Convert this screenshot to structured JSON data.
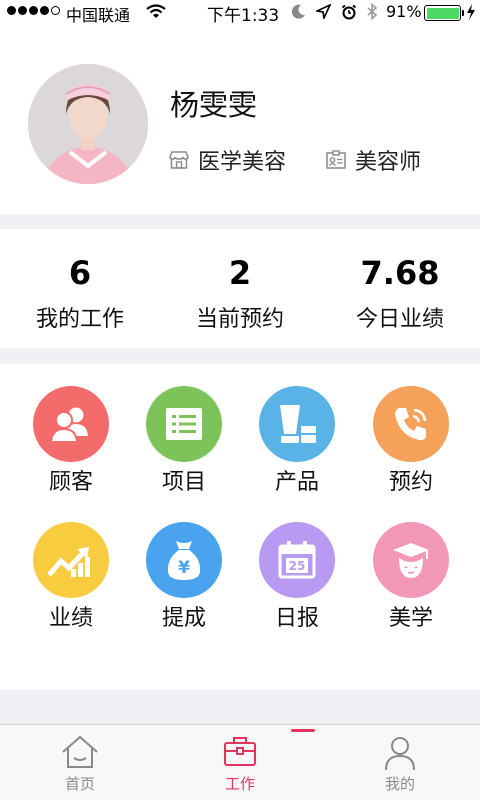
{
  "status_bar": {
    "carrier": "中国联通",
    "time": "下午1:33",
    "battery_percent": "91%",
    "battery_level": 0.91
  },
  "profile": {
    "name": "杨雯雯",
    "tags": [
      {
        "icon": "store-icon",
        "label": "医学美容"
      },
      {
        "icon": "id-card-icon",
        "label": "美容师"
      }
    ]
  },
  "stats": [
    {
      "value": "6",
      "label": "我的工作"
    },
    {
      "value": "2",
      "label": "当前预约"
    },
    {
      "value": "7.68",
      "label": "今日业绩"
    }
  ],
  "menu": [
    {
      "label": "顾客",
      "icon": "customers-icon",
      "color": "#f46b6b"
    },
    {
      "label": "项目",
      "icon": "list-icon",
      "color": "#7cc45a"
    },
    {
      "label": "产品",
      "icon": "product-icon",
      "color": "#5ab3e6"
    },
    {
      "label": "预约",
      "icon": "phone-icon",
      "color": "#f5a15a"
    },
    {
      "label": "业绩",
      "icon": "growth-icon",
      "color": "#f7cc3e"
    },
    {
      "label": "提成",
      "icon": "money-bag-icon",
      "color": "#4aa3ef"
    },
    {
      "label": "日报",
      "icon": "calendar-icon",
      "color": "#b89af3"
    },
    {
      "label": "美学",
      "icon": "graduate-icon",
      "color": "#f297b6"
    }
  ],
  "calendar_day": "25",
  "currency_symbol": "¥",
  "tabbar": {
    "items": [
      {
        "label": "首页",
        "icon": "home-icon",
        "active": false
      },
      {
        "label": "工作",
        "icon": "briefcase-icon",
        "active": true
      },
      {
        "label": "我的",
        "icon": "person-icon",
        "active": false
      }
    ]
  }
}
